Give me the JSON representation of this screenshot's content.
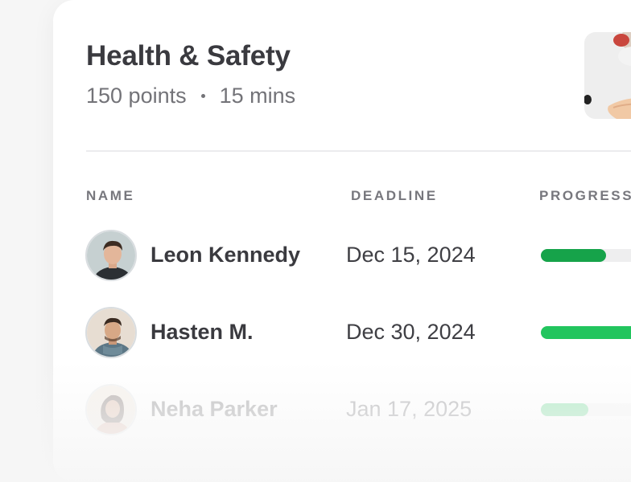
{
  "course": {
    "title": "Health & Safety",
    "points": "150 points",
    "duration": "15 mins"
  },
  "columns": {
    "name": "NAME",
    "deadline": "DEADLINE",
    "progress": "PROGRESS"
  },
  "rows": [
    {
      "name": "Leon Kennedy",
      "deadline": "Dec 15, 2024",
      "progress": 0.58,
      "color": "#16a34a"
    },
    {
      "name": "Hasten M.",
      "deadline": "Dec 30, 2024",
      "progress": 1.0,
      "color": "#22c55e"
    },
    {
      "name": "Neha Parker",
      "deadline": "Jan 17, 2025",
      "progress": 0.42,
      "color": "#22c55e"
    }
  ],
  "colors": {
    "accent_green": "#16a34a",
    "text_dark": "#3a3a3f",
    "text_muted": "#737378"
  },
  "icons": {
    "course_thumbnail": "hand-washing-photo"
  }
}
